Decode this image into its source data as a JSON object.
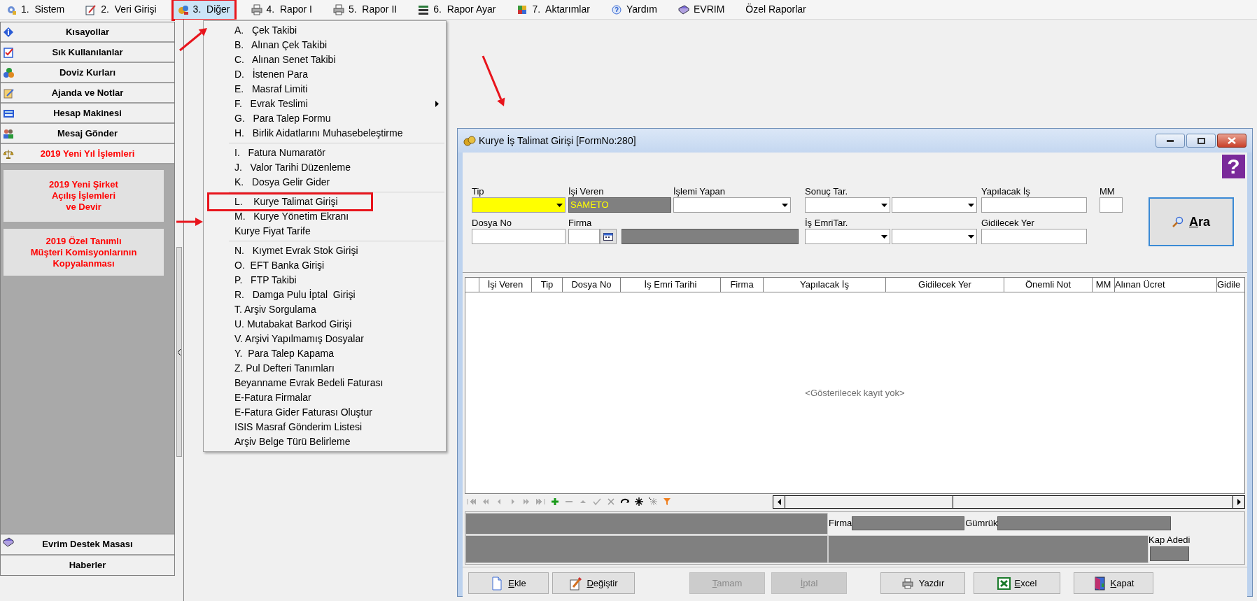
{
  "menu_bar": [
    {
      "label": "1.  Sistem",
      "selected": false
    },
    {
      "label": "2.  Veri Girişi",
      "selected": false
    },
    {
      "label": "3.  Diğer",
      "selected": true
    },
    {
      "label": "4.  Rapor I",
      "selected": false
    },
    {
      "label": "5.  Rapor II",
      "selected": false
    },
    {
      "label": "6.  Rapor Ayar",
      "selected": false
    },
    {
      "label": "7.  Aktarımlar",
      "selected": false
    },
    {
      "label": "Yardım",
      "selected": false
    },
    {
      "label": "EVRIM",
      "selected": false
    },
    {
      "label": "Özel Raporlar",
      "selected": false
    }
  ],
  "sidebar": {
    "top_items": [
      {
        "label": "Kısayollar",
        "color": "#000000"
      },
      {
        "label": "Sık Kullanılanlar",
        "color": "#000000"
      },
      {
        "label": "Doviz Kurları",
        "color": "#000000"
      },
      {
        "label": "Ajanda ve Notlar",
        "color": "#000000"
      },
      {
        "label": "Hesap Makinesi",
        "color": "#000000"
      },
      {
        "label": "Mesaj Gönder",
        "color": "#000000"
      },
      {
        "label": "2019 Yeni Yıl İşlemleri",
        "color": "#ff0000"
      }
    ],
    "panel_buttons": [
      {
        "label": "2019 Yeni Şirket\nAçılış İşlemleri\n ve Devir"
      },
      {
        "label": "2019 Özel Tanımlı\nMüşteri Komisyonlarının\nKopyalanması"
      }
    ],
    "bottom_items": [
      {
        "label": "Evrim Destek Masası"
      },
      {
        "label": "Haberler"
      }
    ]
  },
  "dropdown_menu": {
    "sections": [
      [
        {
          "label": "A.   Çek Takibi",
          "has_submenu": false,
          "marked": false
        },
        {
          "label": "B.   Alınan Çek Takibi",
          "has_submenu": false,
          "marked": false
        },
        {
          "label": "C.   Alınan Senet Takibi",
          "has_submenu": false,
          "marked": false
        },
        {
          "label": "D.   İstenen Para",
          "has_submenu": false,
          "marked": false
        },
        {
          "label": "E.   Masraf Limiti",
          "has_submenu": false,
          "marked": false
        },
        {
          "label": "F.   Evrak Teslimi",
          "has_submenu": true,
          "marked": false
        },
        {
          "label": "G.   Para Talep Formu",
          "has_submenu": false,
          "marked": false
        },
        {
          "label": "H.   Birlik Aidatlarını Muhasebeleştirme",
          "has_submenu": false,
          "marked": false
        }
      ],
      [
        {
          "label": "I.   Fatura Numaratör",
          "has_submenu": false,
          "marked": false
        },
        {
          "label": "J.   Valor Tarihi Düzenleme",
          "has_submenu": false,
          "marked": false
        },
        {
          "label": "K.   Dosya Gelir Gider",
          "has_submenu": false,
          "marked": false
        }
      ],
      [
        {
          "label": "L.    Kurye Talimat Girişi",
          "has_submenu": false,
          "marked": true
        },
        {
          "label": "M.   Kurye Yönetim Ekranı",
          "has_submenu": false,
          "marked": false
        },
        {
          "label": "Kurye Fiyat Tarife",
          "has_submenu": false,
          "marked": false
        }
      ],
      [
        {
          "label": "N.   Kıymet Evrak Stok Girişi",
          "has_submenu": false,
          "marked": false
        },
        {
          "label": "O.  EFT Banka Girişi",
          "has_submenu": false,
          "marked": false
        },
        {
          "label": "P.   FTP Takibi",
          "has_submenu": false,
          "marked": false
        },
        {
          "label": "R.   Damga Pulu İptal  Girişi",
          "has_submenu": false,
          "marked": false
        },
        {
          "label": "T. Arşiv Sorgulama",
          "has_submenu": false,
          "marked": false
        },
        {
          "label": "U. Mutabakat Barkod Girişi",
          "has_submenu": false,
          "marked": false
        },
        {
          "label": "V. Arşivi Yapılmamış Dosyalar",
          "has_submenu": false,
          "marked": false
        },
        {
          "label": "Y.  Para Talep Kapama",
          "has_submenu": false,
          "marked": false
        },
        {
          "label": "Z. Pul Defteri Tanımları",
          "has_submenu": false,
          "marked": false
        },
        {
          "label": "Beyanname Evrak Bedeli Faturası",
          "has_submenu": false,
          "marked": false
        },
        {
          "label": "E-Fatura Firmalar",
          "has_submenu": false,
          "marked": false
        },
        {
          "label": "E-Fatura Gider Faturası Oluştur",
          "has_submenu": false,
          "marked": false
        },
        {
          "label": "ISIS Masraf Gönderim Listesi",
          "has_submenu": false,
          "marked": false
        },
        {
          "label": "Arşiv Belge Türü Belirleme",
          "has_submenu": false,
          "marked": false
        }
      ]
    ]
  },
  "form_window": {
    "title": "Kurye İş Talimat Girişi [FormNo:280]",
    "help_button": "?",
    "filters": {
      "tip": {
        "label": "Tip",
        "focused": true
      },
      "isi_veren": {
        "label": "İşi Veren",
        "value": "SAMETO"
      },
      "islemi_yapan": {
        "label": "İşlemi Yapan"
      },
      "sonuc_tar": {
        "label": "Sonuç Tar."
      },
      "yapilacak_is": {
        "label": "Yapılacak İş"
      },
      "mm": {
        "label": "MM"
      },
      "dosya_no": {
        "label": "Dosya No"
      },
      "firma": {
        "label": "Firma"
      },
      "is_emri_tar": {
        "label": "İş EmriTar."
      },
      "gidilecek_yer": {
        "label": "Gidilecek Yer"
      }
    },
    "search_button": {
      "label": "Ara"
    },
    "table": {
      "columns": [
        "İşi Veren",
        "Tip",
        "Dosya No",
        "İş Emri Tarihi",
        "Firma",
        "Yapılacak İş",
        "Gidilecek Yer",
        "Önemli Not",
        "MM",
        "Alınan Ücret",
        "Gidile"
      ],
      "empty_message": "<Gösterilecek kayıt yok>"
    },
    "detail_labels": {
      "firma": "Firma",
      "gumruk": "Gümrük",
      "kap_adedi": "Kap Adedi"
    },
    "buttons": [
      {
        "label": "Ekle",
        "disabled": false,
        "mnemonic": true
      },
      {
        "label": "Değiştir",
        "disabled": false,
        "mnemonic": true
      },
      {
        "label": "Tamam",
        "disabled": true,
        "mnemonic": true
      },
      {
        "label": "İptal",
        "disabled": true,
        "mnemonic": true
      },
      {
        "label": "Yazdır",
        "disabled": false,
        "mnemonic": false
      },
      {
        "label": "Excel",
        "disabled": false,
        "mnemonic": true
      },
      {
        "label": "Kapat",
        "disabled": false,
        "mnemonic": true
      }
    ]
  },
  "annotations": [
    {
      "kind": "arrow"
    },
    {
      "kind": "arrow"
    },
    {
      "kind": "arrow"
    }
  ]
}
